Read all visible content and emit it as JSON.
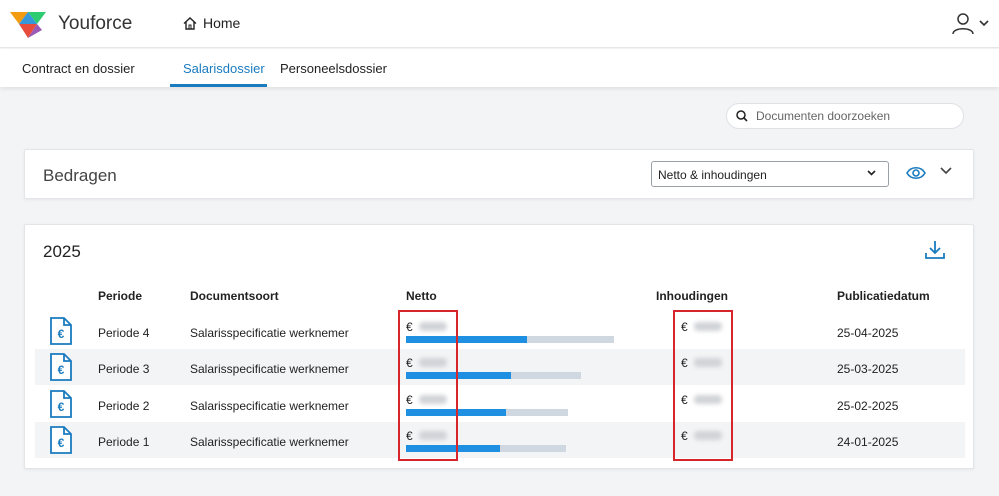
{
  "app": {
    "brand": "Youforce",
    "home_label": "Home"
  },
  "tabs": [
    {
      "label": "Contract en dossier",
      "active": false
    },
    {
      "label": "Salarisdossier",
      "active": true
    },
    {
      "label": "Personeelsdossier",
      "active": false
    }
  ],
  "search": {
    "placeholder": "Documenten doorzoeken"
  },
  "amounts": {
    "title": "Bedragen",
    "select_value": "Netto & inhoudingen"
  },
  "year": {
    "title": "2025",
    "columns": [
      "Periode",
      "Documentsoort",
      "Netto",
      "Inhoudingen",
      "Publicatiedatum"
    ],
    "rows": [
      {
        "period": "Periode 4",
        "type": "Salarisspecificatie werknemer",
        "currency": "€",
        "netto_bar_percent": 58,
        "netto_bar_track_percent": 100,
        "date": "25-04-2025"
      },
      {
        "period": "Periode 3",
        "type": "Salarisspecificatie werknemer",
        "currency": "€",
        "netto_bar_percent": 60,
        "netto_bar_track_percent": 84,
        "date": "25-03-2025"
      },
      {
        "period": "Periode 2",
        "type": "Salarisspecificatie werknemer",
        "currency": "€",
        "netto_bar_percent": 62,
        "netto_bar_track_percent": 78,
        "date": "25-02-2025"
      },
      {
        "period": "Periode 1",
        "type": "Salarisspecificatie werknemer",
        "currency": "€",
        "netto_bar_percent": 59,
        "netto_bar_track_percent": 77,
        "date": "24-01-2025"
      }
    ]
  },
  "colors": {
    "accent": "#1a7bbf",
    "bar_fill": "#1e8fe1",
    "bar_track": "#cfd8e1",
    "highlight": "#d6262b"
  },
  "icons": [
    "home-icon",
    "user-icon",
    "chevron-down-icon",
    "search-icon",
    "eye-icon",
    "download-icon",
    "euro-document-icon"
  ]
}
